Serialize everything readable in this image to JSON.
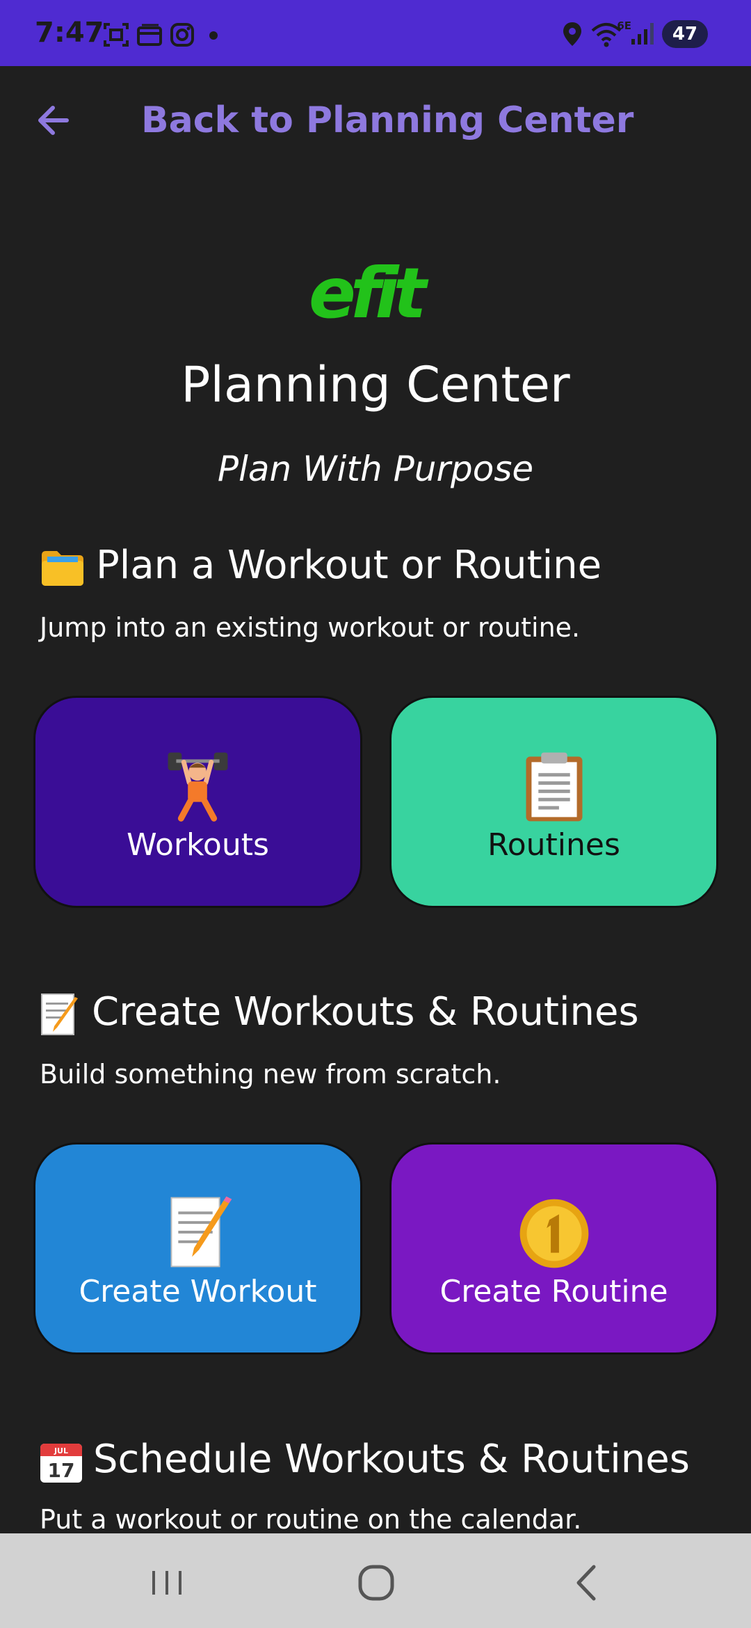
{
  "status_bar": {
    "time": "7:47",
    "network_type": "6E",
    "battery_level": "47",
    "icons": [
      "screenshot-icon",
      "wallet-icon",
      "instagram-icon",
      "dot-icon",
      "location-icon",
      "wifi-icon",
      "signal-icon",
      "battery-icon"
    ]
  },
  "header": {
    "back_label": "Back to Planning Center"
  },
  "hero": {
    "logo_text": "efit",
    "title": "Planning Center",
    "subtitle": "Plan With Purpose"
  },
  "sections": [
    {
      "heading": "Plan a Workout or Routine",
      "icon": "folder-icon",
      "description": "Jump into an existing workout or routine.",
      "tiles": [
        {
          "label": "Workouts",
          "icon": "weightlifter-icon",
          "color": "#3a0d96",
          "text_color": "#ffffff"
        },
        {
          "label": "Routines",
          "icon": "clipboard-icon",
          "color": "#38d39f",
          "text_color": "#111111"
        }
      ]
    },
    {
      "heading": "Create Workouts & Routines",
      "icon": "memo-icon",
      "description": "Build something new from scratch.",
      "tiles": [
        {
          "label": "Create Workout",
          "icon": "memo-icon",
          "color": "#2286d6",
          "text_color": "#ffffff"
        },
        {
          "label": "Create Routine",
          "icon": "number-one-coin-icon",
          "color": "#7a18c2",
          "text_color": "#ffffff"
        }
      ]
    },
    {
      "heading": "Schedule Workouts & Routines",
      "icon": "calendar-icon",
      "calendar_month": "JUL",
      "calendar_day": "17",
      "description": "Put a workout or routine on the calendar."
    }
  ],
  "colors": {
    "status_bar": "#4f2bd1",
    "background": "#1f1f1f",
    "accent": "#8e79df",
    "logo_green": "#22c21a",
    "nav_bar": "#d2d2d2"
  },
  "nav_bar": {
    "buttons": [
      "recents-icon",
      "home-icon",
      "back-icon"
    ]
  }
}
